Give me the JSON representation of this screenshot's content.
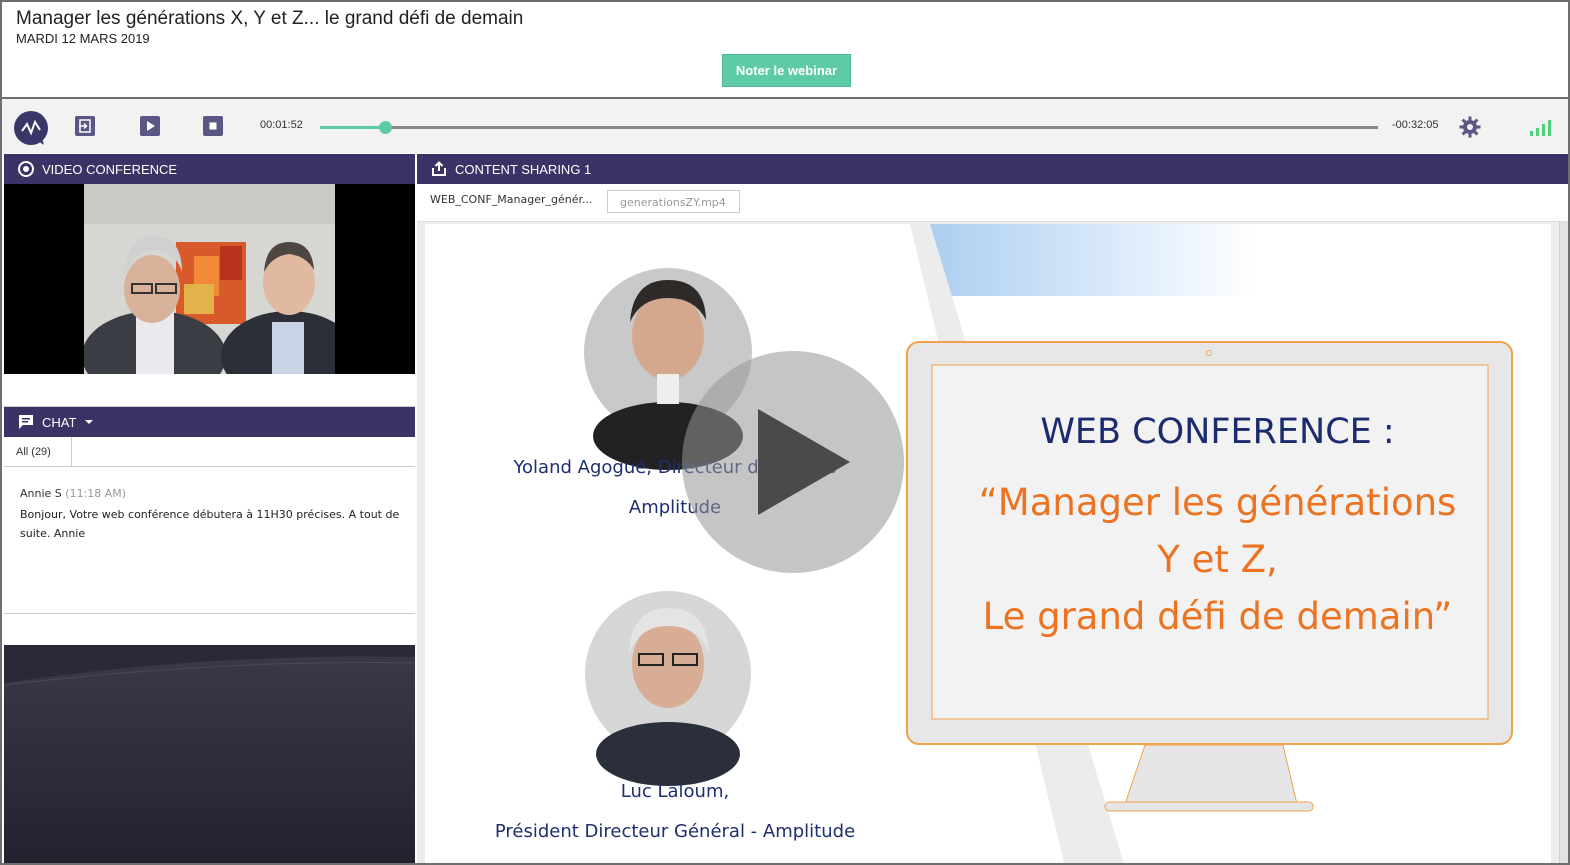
{
  "header": {
    "title": "Manager les générations X, Y et Z... le grand défi de demain",
    "date": "MARDI 12 MARS 2019",
    "rate_button": "Noter le webinar"
  },
  "player": {
    "elapsed": "00:01:52",
    "remaining": "-00:32:05",
    "progress_fraction": 0.061,
    "accent_color": "#5fcaa6"
  },
  "video_section": {
    "label": "VIDEO CONFERENCE",
    "icon": "target-icon"
  },
  "chat": {
    "label": "CHAT",
    "tab": "All (29)",
    "messages": [
      {
        "author": "Annie S",
        "time": "(11:18 AM)",
        "text": "Bonjour, Votre web conférence débutera à 11H30 précises. A tout de suite. Annie"
      }
    ]
  },
  "content_section": {
    "label": "CONTENT SHARING 1",
    "tabs": [
      "WEB_CONF_Manager_génér...",
      "generationsZY.mp4"
    ]
  },
  "slide": {
    "speaker1_name": "Yoland Agogué, Directeur de Projets",
    "speaker1_org": "Amplitude",
    "speaker2_name": "Luc Laloum,",
    "speaker2_title": "Président Directeur Général - Amplitude",
    "heading": "WEB CONFERENCE :",
    "quote_line1": "“Manager les générations",
    "quote_line2": "Y et Z,",
    "quote_line3": "Le grand défi de demain”"
  },
  "colors": {
    "brand_purple": "#3a3466",
    "teal": "#5fcaa6",
    "orange": "#ec7322",
    "navy": "#1c2a6e"
  }
}
